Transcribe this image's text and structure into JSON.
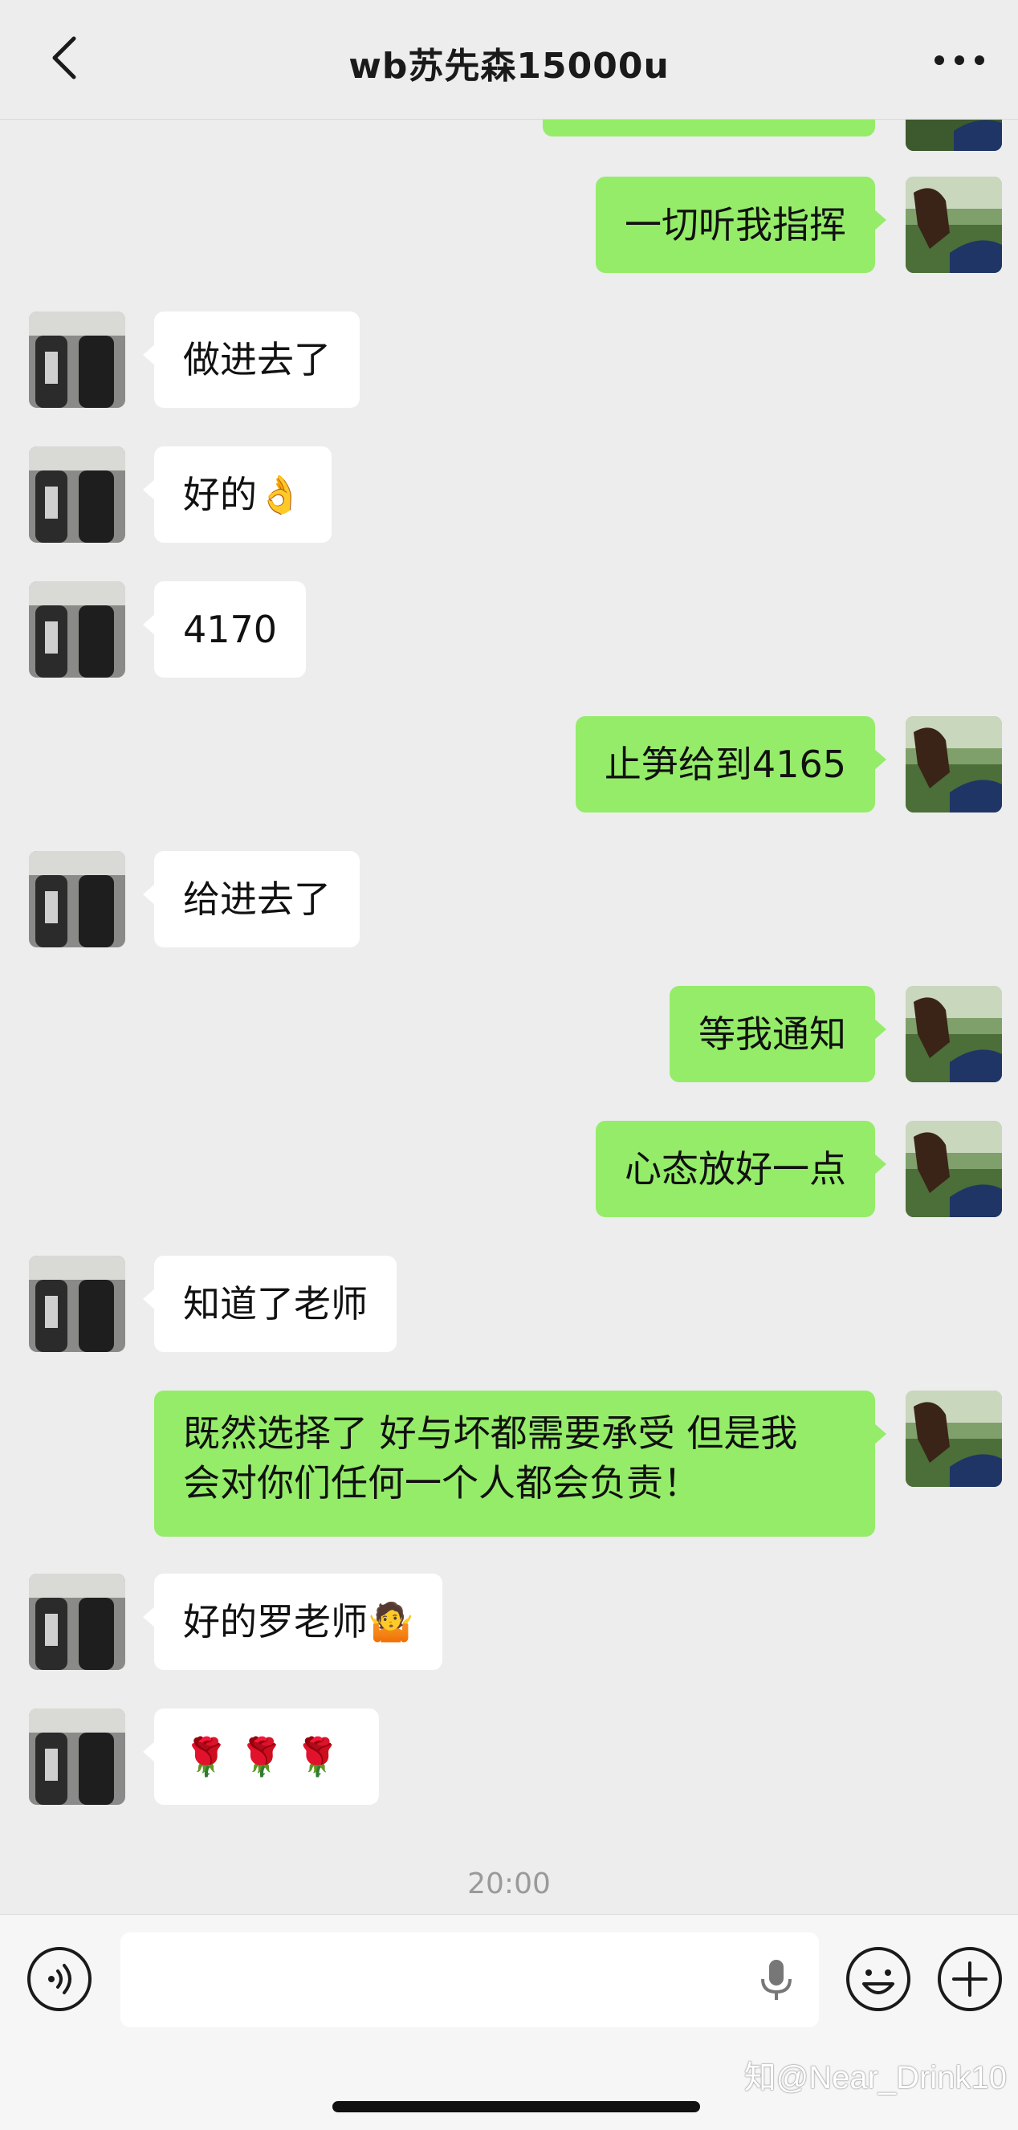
{
  "header": {
    "title": "wb苏先森15000u"
  },
  "messages": [
    {
      "side": "out",
      "text": "一切听我指挥"
    },
    {
      "side": "in",
      "text": "做进去了"
    },
    {
      "side": "in",
      "text": "好的👌"
    },
    {
      "side": "in",
      "text": "4170"
    },
    {
      "side": "out",
      "text": "止笋给到4165"
    },
    {
      "side": "in",
      "text": "给进去了"
    },
    {
      "side": "out",
      "text": "等我通知"
    },
    {
      "side": "out",
      "text": "心态放好一点"
    },
    {
      "side": "in",
      "text": "知道了老师"
    },
    {
      "side": "out",
      "text": "既然选择了 好与坏都需要承受 但是我\n会对你们任何一个人都会负责！"
    },
    {
      "side": "in",
      "text": "好的罗老师🤷"
    },
    {
      "side": "in",
      "text": "🌹🌹🌹"
    }
  ],
  "timestamp": "20:00",
  "watermark": "知@Near_Drink10",
  "icons": {
    "back": "chevron-left-icon",
    "more": "more-dots-icon",
    "voice": "voice-icon",
    "mic": "microphone-icon",
    "emoji": "emoji-icon",
    "plus": "plus-icon"
  },
  "colors": {
    "outgoing_bubble": "#95ec69",
    "incoming_bubble": "#ffffff",
    "background": "#ededed"
  }
}
